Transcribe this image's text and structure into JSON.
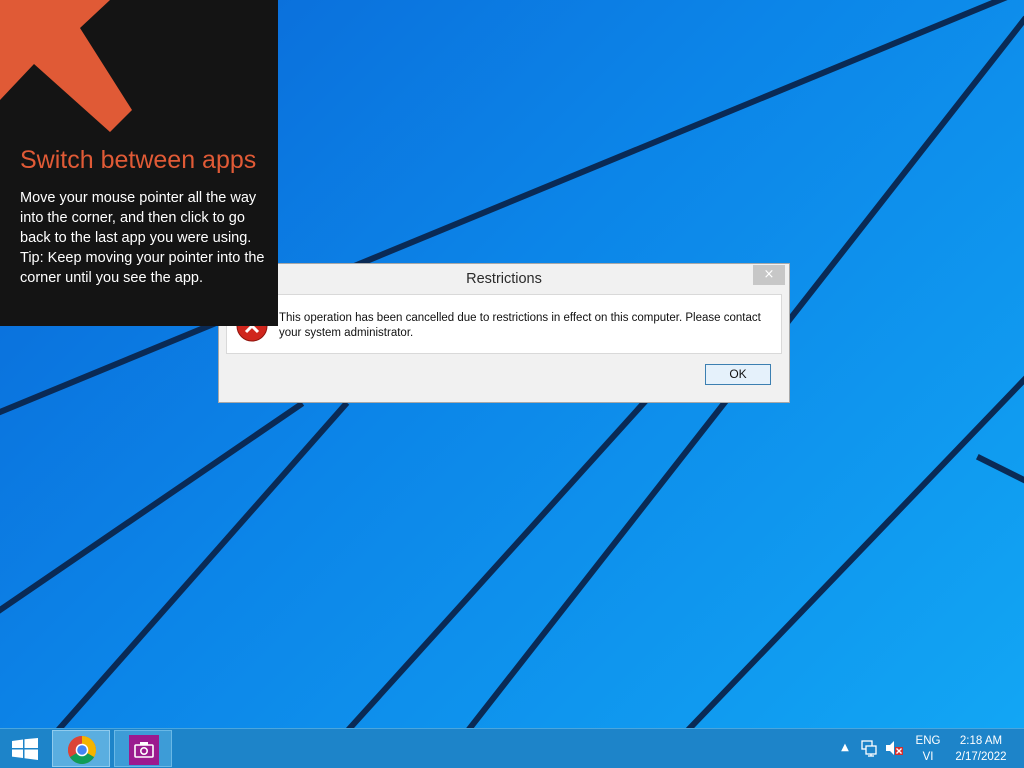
{
  "tip": {
    "title": "Switch between apps",
    "line1": "Move your mouse pointer all the way into the corner, and then click to go back to the last app you were using.",
    "line2": "Tip: Keep moving your pointer into the corner until you see the app.",
    "accent_color": "#e05a36",
    "icon": "corner-arrow-icon"
  },
  "dialog": {
    "title": "Restrictions",
    "close_glyph": "×",
    "message": "This operation has been cancelled due to restrictions in effect on this computer. Please contact your system administrator.",
    "ok_label": "OK",
    "icon": "error-icon"
  },
  "taskbar": {
    "start_icon": "windows-logo-icon",
    "apps": [
      {
        "icon": "chrome-icon"
      },
      {
        "icon": "camera-icon"
      }
    ],
    "tray": {
      "chevron": "▲",
      "network_icon": "network-icon",
      "volume_icon": "volume-muted-icon",
      "lang_top": "ENG",
      "lang_bottom": "VI",
      "time": "2:18 AM",
      "date": "2/17/2022"
    }
  },
  "colors": {
    "taskbar": "#1d84c9",
    "wallpaper": "#0c85e8",
    "tip_background": "#141414"
  }
}
